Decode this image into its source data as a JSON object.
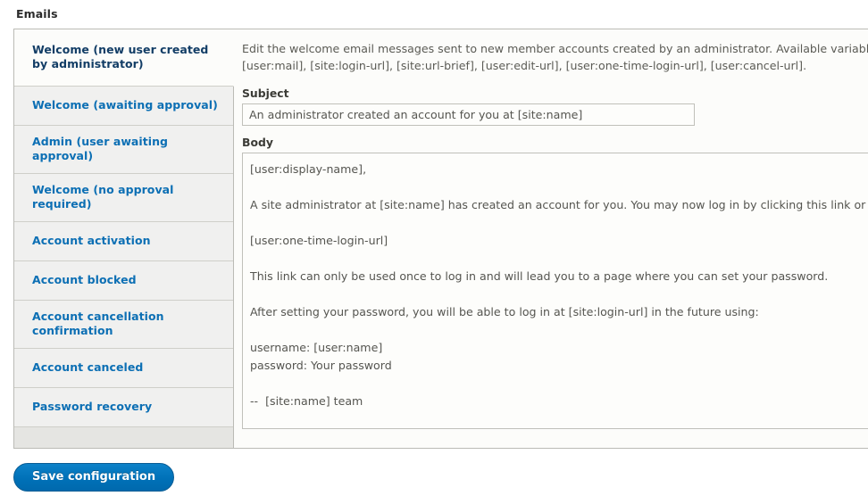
{
  "section": {
    "title": "Emails"
  },
  "tabs": [
    {
      "label": "Welcome (new user created by administrator)",
      "selected": true
    },
    {
      "label": "Welcome (awaiting approval)",
      "selected": false
    },
    {
      "label": "Admin (user awaiting approval)",
      "selected": false
    },
    {
      "label": "Welcome (no approval required)",
      "selected": false
    },
    {
      "label": "Account activation",
      "selected": false
    },
    {
      "label": "Account blocked",
      "selected": false
    },
    {
      "label": "Account cancellation confirmation",
      "selected": false
    },
    {
      "label": "Account canceled",
      "selected": false
    },
    {
      "label": "Password recovery",
      "selected": false
    }
  ],
  "pane": {
    "description": "Edit the welcome email messages sent to new member accounts created by an administrator. Available variables are: [site:name], [site:url], [user:display-name], [user:account-name], [user:mail], [site:login-url], [site:url-brief], [user:edit-url], [user:one-time-login-url], [user:cancel-url].",
    "subject": {
      "label": "Subject",
      "value": "An administrator created an account for you at [site:name]",
      "placeholder": ""
    },
    "body": {
      "label": "Body",
      "value": "[user:display-name],\n\nA site administrator at [site:name] has created an account for you. You may now log in by clicking this link or copying and pasting it into your browser:\n\n[user:one-time-login-url]\n\nThis link can only be used once to log in and will lead you to a page where you can set your password.\n\nAfter setting your password, you will be able to log in at [site:login-url] in the future using:\n\nusername: [user:name]\npassword: Your password\n\n--  [site:name] team",
      "placeholder": ""
    }
  },
  "actions": {
    "save_label": "Save configuration"
  },
  "colors": {
    "link_blue": "#0c6fb4",
    "selected_tab_text": "#123d66",
    "button_blue": "#0071b8",
    "pane_background": "#fcfcfa",
    "tab_background": "#f0f0ef",
    "filler_background": "#e5e5e2"
  }
}
